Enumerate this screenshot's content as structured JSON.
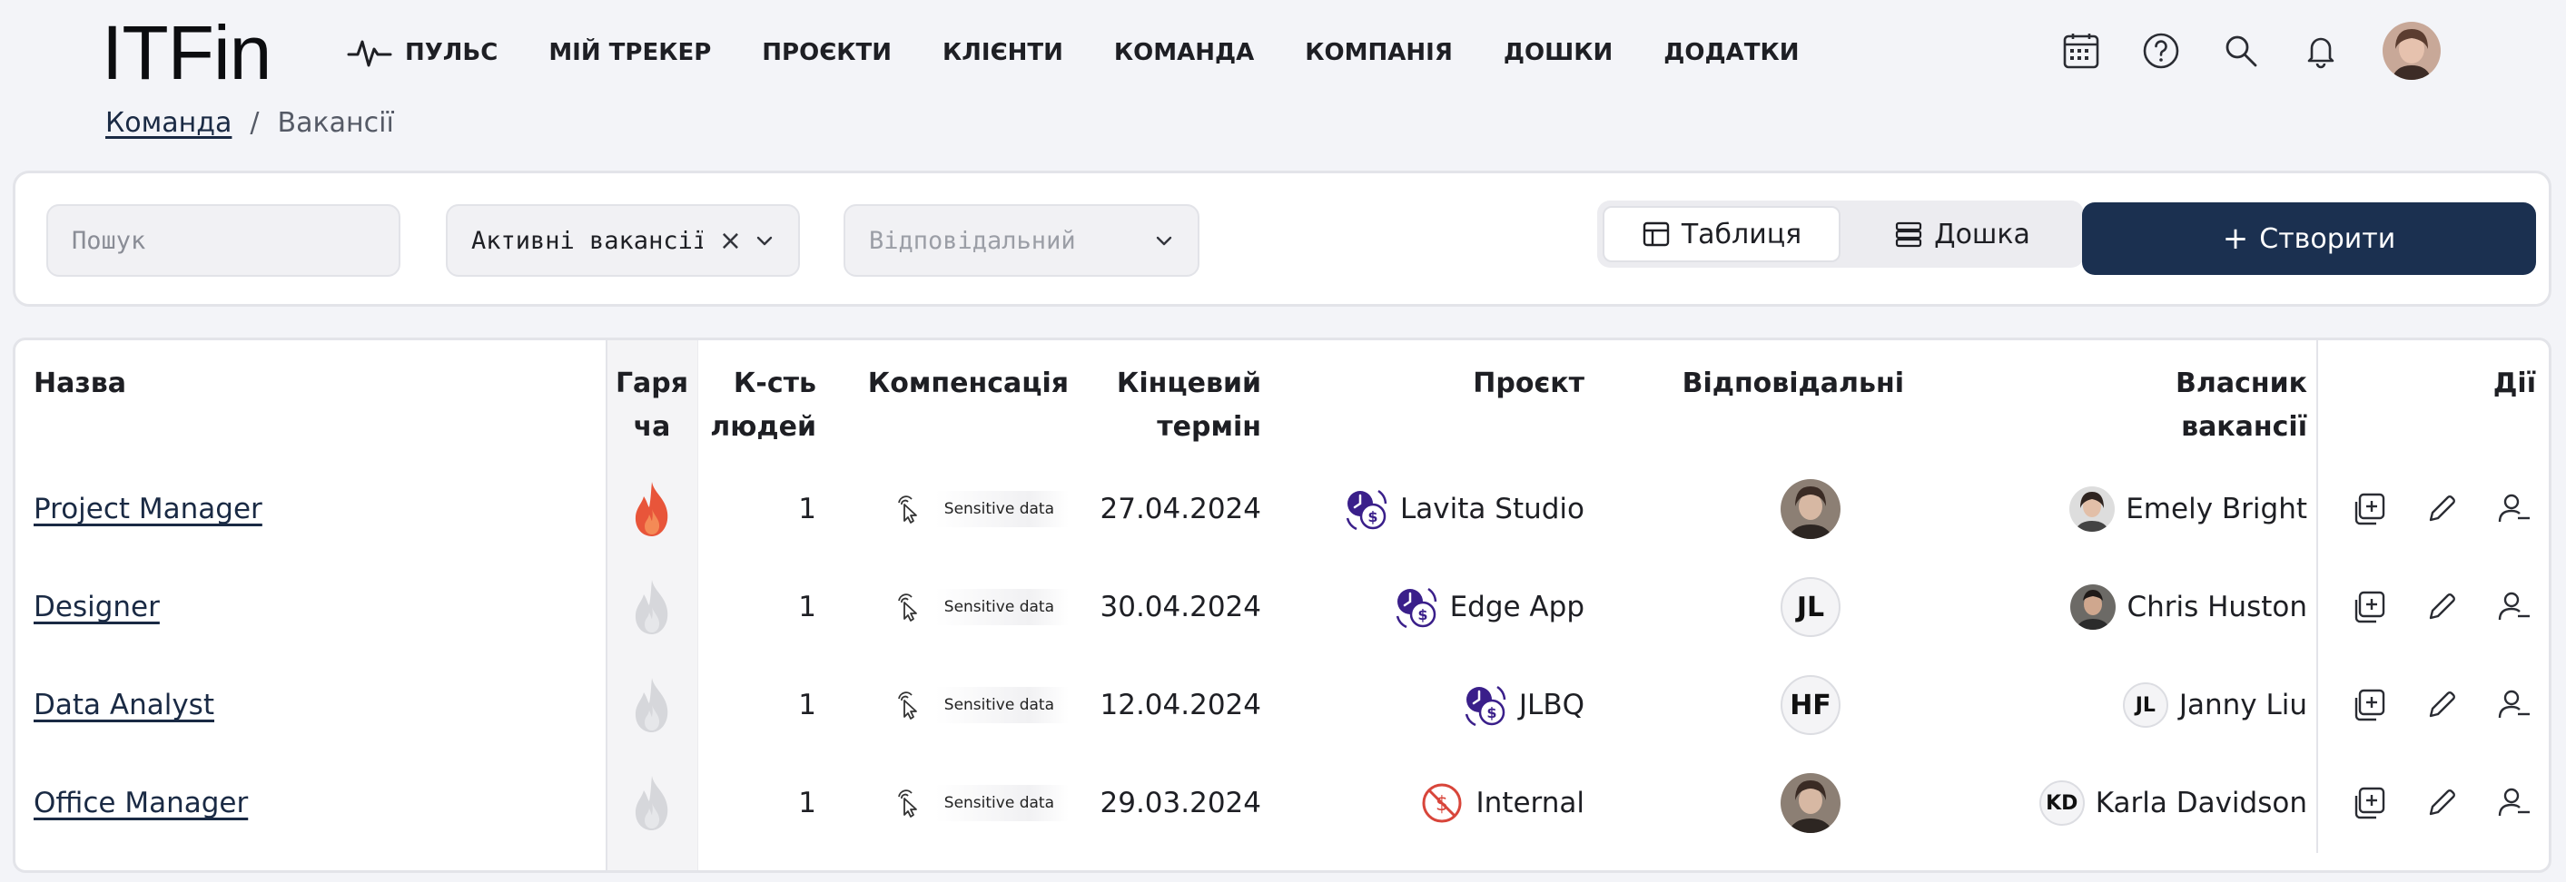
{
  "app": {
    "logo": "ITFin"
  },
  "nav": {
    "items": [
      {
        "label": "ПУЛЬС",
        "icon": "pulse-icon"
      },
      {
        "label": "МІЙ ТРЕКЕР"
      },
      {
        "label": "ПРОЄКТИ"
      },
      {
        "label": "КЛІЄНТИ"
      },
      {
        "label": "КОМАНДА"
      },
      {
        "label": "КОМПАНІЯ"
      },
      {
        "label": "ДОШКИ"
      },
      {
        "label": "ДОДАТКИ"
      }
    ],
    "icons": [
      "calendar-icon",
      "help-icon",
      "search-icon",
      "bell-icon",
      "user-avatar"
    ]
  },
  "breadcrumb": {
    "parent": "Команда",
    "separator": "/",
    "current": "Вакансії"
  },
  "filters": {
    "search_placeholder": "Пошук",
    "status_value": "Активні вакансії",
    "responsible_placeholder": "Відповідальний",
    "view_table_label": "Таблиця",
    "view_board_label": "Дошка",
    "create_label": "Створити"
  },
  "table": {
    "headers": {
      "name": "Назва",
      "hot": "Гаря ча",
      "count": "К-сть людей",
      "comp": "Компенсація",
      "deadline": "Кінцевий термін",
      "project": "Проєкт",
      "responsible": "Відповідальні",
      "owner": "Власник вакансії",
      "actions": "Дії"
    },
    "rows": [
      {
        "name": "Project Manager",
        "hot": true,
        "count": "1",
        "comp": "Sensitive data",
        "deadline": "27.04.2024",
        "project": "Lavita Studio",
        "project_icon": "billing-clock-icon",
        "responsible": {
          "type": "photo"
        },
        "owner": {
          "name": "Emely Bright",
          "type": "photo"
        }
      },
      {
        "name": "Designer",
        "hot": false,
        "count": "1",
        "comp": "Sensitive data",
        "deadline": "30.04.2024",
        "project": "Edge App",
        "project_icon": "billing-clock-icon",
        "responsible": {
          "type": "initials",
          "initials": "JL"
        },
        "owner": {
          "name": "Chris Huston",
          "type": "photo"
        }
      },
      {
        "name": "Data Analyst",
        "hot": false,
        "count": "1",
        "comp": "Sensitive data",
        "deadline": "12.04.2024",
        "project": "JLBQ",
        "project_icon": "billing-clock-icon",
        "responsible": {
          "type": "initials",
          "initials": "HF"
        },
        "owner": {
          "name": "Janny Liu",
          "type": "initials",
          "initials": "JL"
        }
      },
      {
        "name": "Office Manager",
        "hot": false,
        "count": "1",
        "comp": "Sensitive data",
        "deadline": "29.03.2024",
        "project": "Internal",
        "project_icon": "no-billing-icon",
        "responsible": {
          "type": "photo"
        },
        "owner": {
          "name": "Karla Davidson",
          "type": "initials",
          "initials": "KD"
        }
      }
    ]
  },
  "colors": {
    "primary": "#1b3050",
    "hot": "#e8553a",
    "hot_inactive": "#d6d7db",
    "project_icon": "#3a1f8a",
    "internal_icon": "#d8453a"
  }
}
